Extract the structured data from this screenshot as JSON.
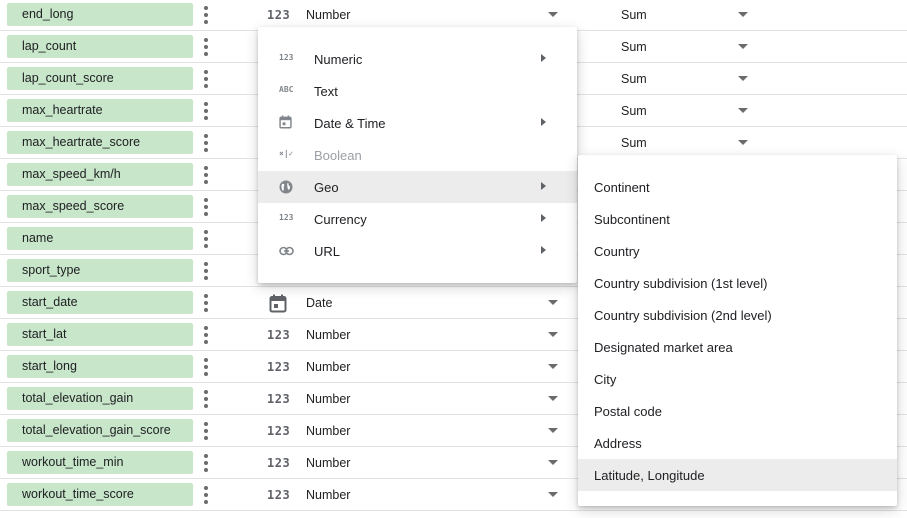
{
  "fields": [
    {
      "name": "end_long",
      "type": "Number",
      "type_icon": "123",
      "aggregation": "Sum"
    },
    {
      "name": "lap_count",
      "type": "",
      "type_icon": "",
      "aggregation": "Sum"
    },
    {
      "name": "lap_count_score",
      "type": "",
      "type_icon": "",
      "aggregation": "Sum"
    },
    {
      "name": "max_heartrate",
      "type": "",
      "type_icon": "",
      "aggregation": "Sum"
    },
    {
      "name": "max_heartrate_score",
      "type": "",
      "type_icon": "",
      "aggregation": "Sum"
    },
    {
      "name": "max_speed_km/h",
      "type": "",
      "type_icon": "",
      "aggregation": ""
    },
    {
      "name": "max_speed_score",
      "type": "",
      "type_icon": "",
      "aggregation": ""
    },
    {
      "name": "name",
      "type": "",
      "type_icon": "",
      "aggregation": ""
    },
    {
      "name": "sport_type",
      "type": "",
      "type_icon": "",
      "aggregation": ""
    },
    {
      "name": "start_date",
      "type": "Date",
      "type_icon": "calendar-icon",
      "aggregation": ""
    },
    {
      "name": "start_lat",
      "type": "Number",
      "type_icon": "123",
      "aggregation": ""
    },
    {
      "name": "start_long",
      "type": "Number",
      "type_icon": "123",
      "aggregation": ""
    },
    {
      "name": "total_elevation_gain",
      "type": "Number",
      "type_icon": "123",
      "aggregation": ""
    },
    {
      "name": "total_elevation_gain_score",
      "type": "Number",
      "type_icon": "123",
      "aggregation": ""
    },
    {
      "name": "workout_time_min",
      "type": "Number",
      "type_icon": "123",
      "aggregation": ""
    },
    {
      "name": "workout_time_score",
      "type": "Number",
      "type_icon": "123",
      "aggregation": ""
    }
  ],
  "type_menu": [
    {
      "icon": "123",
      "label": "Numeric",
      "submenu": true,
      "disabled": false,
      "highlighted": false
    },
    {
      "icon": "ABC",
      "label": "Text",
      "submenu": false,
      "disabled": false,
      "highlighted": false
    },
    {
      "icon": "calendar-icon",
      "label": "Date & Time",
      "submenu": true,
      "disabled": false,
      "highlighted": false
    },
    {
      "icon": "×|✓",
      "label": "Boolean",
      "submenu": false,
      "disabled": true,
      "highlighted": false
    },
    {
      "icon": "globe-icon",
      "label": "Geo",
      "submenu": true,
      "disabled": false,
      "highlighted": true
    },
    {
      "icon": "123",
      "label": "Currency",
      "submenu": true,
      "disabled": false,
      "highlighted": false
    },
    {
      "icon": "link-icon",
      "label": "URL",
      "submenu": true,
      "disabled": false,
      "highlighted": false
    }
  ],
  "geo_menu": [
    {
      "label": "Continent",
      "highlighted": false
    },
    {
      "label": "Subcontinent",
      "highlighted": false
    },
    {
      "label": "Country",
      "highlighted": false
    },
    {
      "label": "Country subdivision (1st level)",
      "highlighted": false
    },
    {
      "label": "Country subdivision (2nd level)",
      "highlighted": false
    },
    {
      "label": "Designated market area",
      "highlighted": false
    },
    {
      "label": "City",
      "highlighted": false
    },
    {
      "label": "Postal code",
      "highlighted": false
    },
    {
      "label": "Address",
      "highlighted": false
    },
    {
      "label": "Latitude, Longitude",
      "highlighted": true
    }
  ],
  "colors": {
    "chip_bg": "#c8e6c9",
    "highlight_bg": "#ececec",
    "disabled_text": "#9aa0a6"
  }
}
